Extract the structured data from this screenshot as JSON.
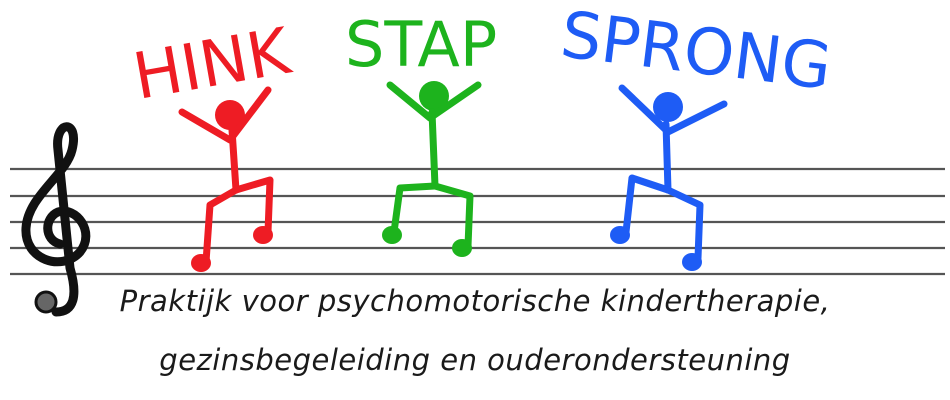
{
  "brand": {
    "words": [
      {
        "text": "HINK",
        "color": "#ee1c24"
      },
      {
        "text": "STAP",
        "color": "#1db31d"
      },
      {
        "text": "SPRONG",
        "color": "#1e5cf5"
      }
    ],
    "tagline_line1": "Praktijk voor psychomotorische kindertherapie,",
    "tagline_line2": "gezinsbegeleiding en ouderondersteuning"
  },
  "graphics": {
    "staff_line_color": "#555555",
    "clef": "treble-clef-icon",
    "figures": [
      "red-stick-figure",
      "green-stick-figure",
      "blue-stick-figure"
    ]
  }
}
